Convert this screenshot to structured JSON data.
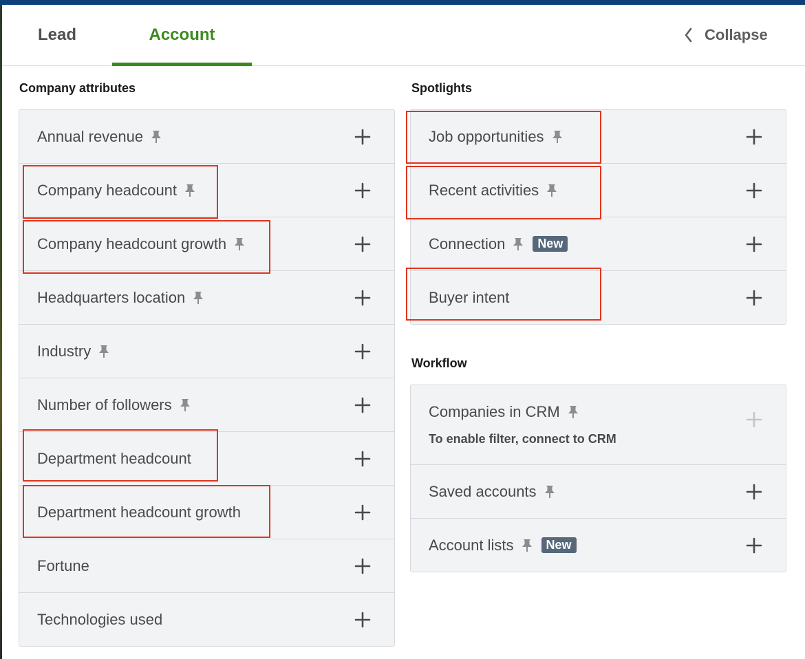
{
  "tabs": {
    "lead": "Lead",
    "account": "Account",
    "collapse": "Collapse"
  },
  "company_attributes": {
    "heading": "Company attributes",
    "items": [
      {
        "label": "Annual revenue",
        "pinned": true
      },
      {
        "label": "Company headcount",
        "pinned": true
      },
      {
        "label": "Company headcount growth",
        "pinned": true
      },
      {
        "label": "Headquarters location",
        "pinned": true
      },
      {
        "label": "Industry",
        "pinned": true
      },
      {
        "label": "Number of followers",
        "pinned": true
      },
      {
        "label": "Department headcount",
        "pinned": false
      },
      {
        "label": "Department headcount growth",
        "pinned": false
      },
      {
        "label": "Fortune",
        "pinned": false
      },
      {
        "label": "Technologies used",
        "pinned": false
      }
    ]
  },
  "spotlights": {
    "heading": "Spotlights",
    "items": [
      {
        "label": "Job opportunities",
        "pinned": true
      },
      {
        "label": "Recent activities",
        "pinned": true
      },
      {
        "label": "Connection",
        "pinned": true,
        "badge": "New"
      },
      {
        "label": "Buyer intent",
        "pinned": false
      }
    ]
  },
  "workflow": {
    "heading": "Workflow",
    "items": [
      {
        "label": "Companies in CRM",
        "pinned": true,
        "note": "To enable filter, connect to CRM",
        "disabled": true
      },
      {
        "label": "Saved accounts",
        "pinned": true
      },
      {
        "label": "Account lists",
        "pinned": true,
        "badge": "New"
      }
    ]
  },
  "colors": {
    "accent": "#3b8a1e",
    "highlight": "#e0341e",
    "badge": "#56687a",
    "panel": "#f2f3f5"
  },
  "icons": {
    "pin": "pin-icon",
    "plus": "plus-icon",
    "chevron": "chevron-left-icon"
  }
}
